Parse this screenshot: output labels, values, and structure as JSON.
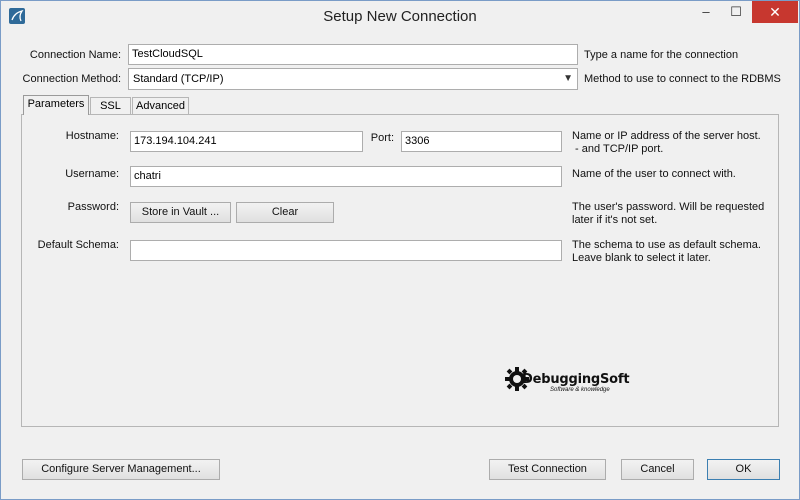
{
  "window": {
    "title": "Setup New Connection",
    "minimize_glyph": "‒",
    "maximize_glyph": "☐",
    "close_glyph": "✕"
  },
  "form": {
    "connection_name_label": "Connection Name:",
    "connection_name_value": "TestCloudSQL",
    "connection_name_hint": "Type a name for the connection",
    "connection_method_label": "Connection Method:",
    "connection_method_value": "Standard (TCP/IP)",
    "connection_method_hint": "Method to use to connect to the RDBMS"
  },
  "tabs": [
    {
      "label": "Parameters",
      "active": true
    },
    {
      "label": "SSL",
      "active": false
    },
    {
      "label": "Advanced",
      "active": false
    }
  ],
  "parameters": {
    "hostname_label": "Hostname:",
    "hostname_value": "173.194.104.241",
    "port_label": "Port:",
    "port_value": "3306",
    "hostname_hint_1": "Name or IP address of the server host.",
    "hostname_hint_2": " - and TCP/IP port.",
    "username_label": "Username:",
    "username_value": "chatri",
    "username_hint": "Name of the user to connect with.",
    "password_label": "Password:",
    "store_in_vault_label": "Store in Vault ...",
    "clear_label": "Clear",
    "password_hint_1": "The user's password. Will be requested",
    "password_hint_2": "later if it's not set.",
    "default_schema_label": "Default Schema:",
    "default_schema_value": "",
    "default_schema_hint_1": "The schema to use as default schema.",
    "default_schema_hint_2": "Leave blank to select it later."
  },
  "watermark": {
    "text": "DebuggingSoft",
    "subtext": "Software & knowledge"
  },
  "footer": {
    "configure_label": "Configure Server Management...",
    "test_connection_label": "Test Connection",
    "cancel_label": "Cancel",
    "ok_label": "OK"
  },
  "colors": {
    "close_button": "#c7372f",
    "default_button_border": "#3c7fb1",
    "app_icon": "#2f6a99"
  },
  "icons": {
    "app": "mysql-workbench-icon",
    "dropdown": "chevron-down-icon",
    "logo": "gear-icon"
  }
}
